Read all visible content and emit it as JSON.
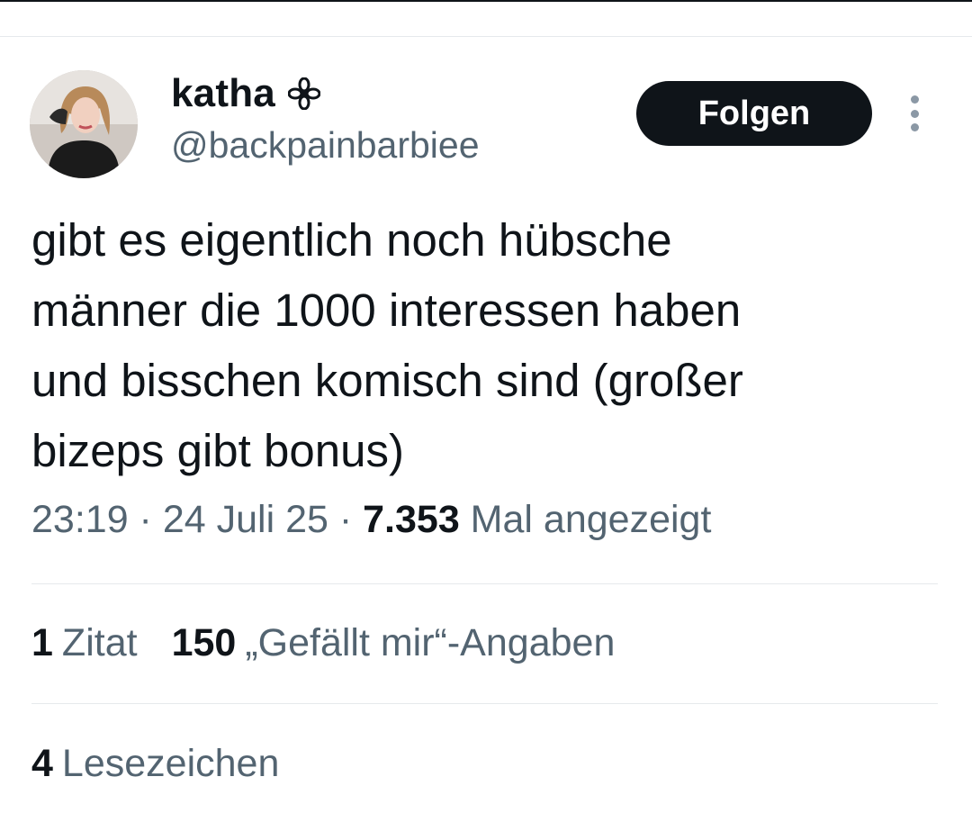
{
  "author": {
    "display_name": "katha",
    "handle": "@backpainbarbiee",
    "badge_icon": "flower-icon",
    "avatar_icon": "profile-photo"
  },
  "follow_button": {
    "label": "Folgen"
  },
  "more_icon": "more-vertical-icon",
  "tweet": {
    "text": "gibt es eigentlich noch hübsche\nmänner die 1000 interessen haben\nund bisschen komisch sind (großer\nbizeps gibt bonus)"
  },
  "meta": {
    "time": "23:19",
    "separator": " · ",
    "date": "24 Juli 25",
    "views_count": "7.353",
    "views_label": " Mal angezeigt"
  },
  "stats": {
    "quotes_count": "1",
    "quotes_label": "Zitat",
    "likes_count": "150",
    "likes_label": "„Gefällt mir“-Angaben",
    "bookmarks_count": "4",
    "bookmarks_label": "Lesezeichen"
  },
  "colors": {
    "text_primary": "#0f1419",
    "text_secondary": "#536471",
    "divider": "#e6e9ec",
    "button_bg": "#0f1419",
    "button_text": "#ffffff"
  }
}
